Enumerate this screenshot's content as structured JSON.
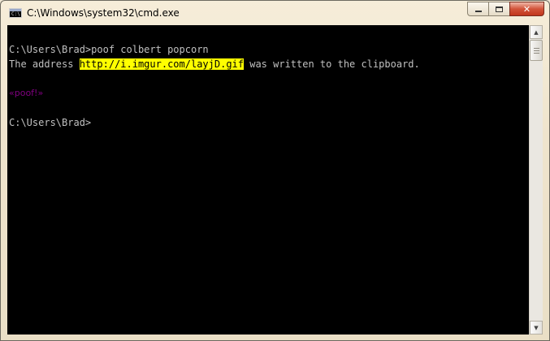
{
  "window": {
    "title": "C:\\Windows\\system32\\cmd.exe",
    "icon_text": "C:\\"
  },
  "caption_buttons": {
    "minimize": "minimize-icon",
    "maximize": "maximize-icon",
    "close": "✕"
  },
  "console": {
    "line1": "C:\\Users\\Brad>poof colbert popcorn",
    "line2_prefix": "The address ",
    "line2_link": "http://i.imgur.com/layjD.gif",
    "line2_suffix": " was written to the clipboard.",
    "poof": "«poof!»",
    "prompt": "C:\\Users\\Brad>",
    "highlight_color": "#ffff00",
    "poof_color": "#800080",
    "text_color": "#c0c0c0"
  },
  "scrollbar": {
    "up_arrow": "▲",
    "down_arrow": "▼"
  }
}
